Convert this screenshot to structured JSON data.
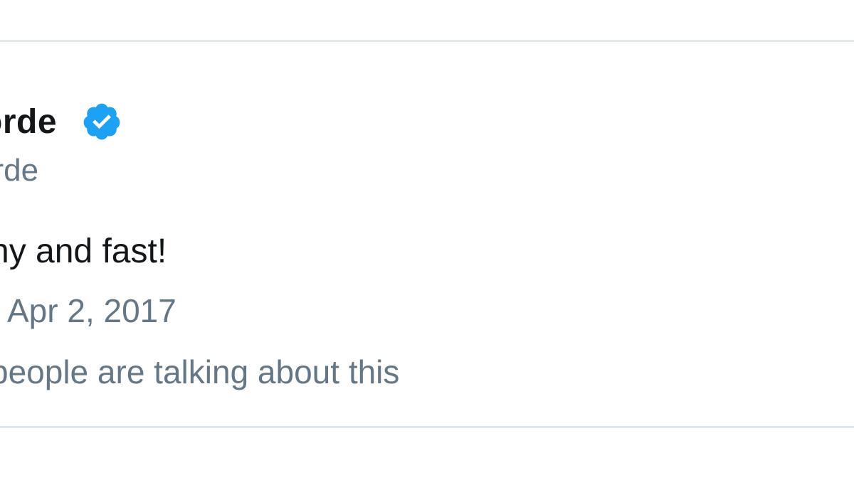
{
  "tweet": {
    "display_name": "orde",
    "handle": "orde",
    "text": "ny and fast!",
    "date": "Apr 2, 2017",
    "engagement": "people are talking about this",
    "verified_icon": "verified-badge-icon",
    "colors": {
      "verified": "#1da1f2",
      "text_primary": "#14171a",
      "text_secondary": "#657786",
      "border": "#e1e8ed"
    }
  }
}
